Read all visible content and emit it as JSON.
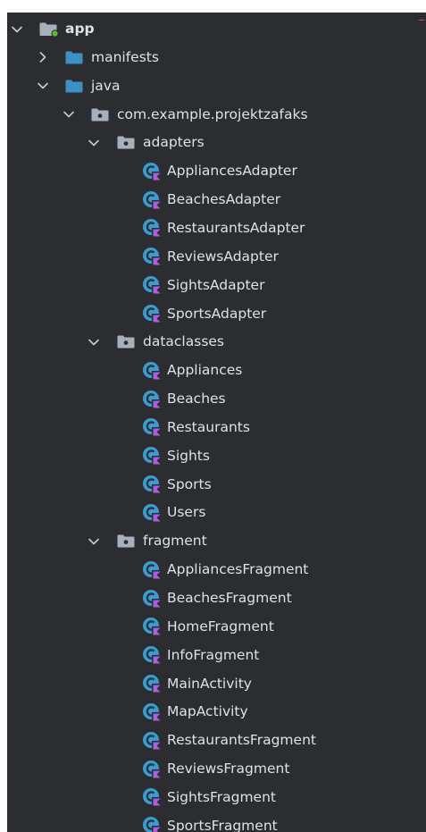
{
  "tree": {
    "root": {
      "label": "app",
      "expanded": true
    },
    "manifests": {
      "label": "manifests",
      "expanded": false
    },
    "java": {
      "label": "java",
      "expanded": true
    },
    "package": {
      "label": "com.example.projektzafaks",
      "expanded": true
    },
    "adapters": {
      "label": "adapters",
      "expanded": true,
      "files": [
        "AppliancesAdapter",
        "BeachesAdapter",
        "RestaurantsAdapter",
        "ReviewsAdapter",
        "SightsAdapter",
        "SportsAdapter"
      ]
    },
    "dataclasses": {
      "label": "dataclasses",
      "expanded": true,
      "files": [
        "Appliances",
        "Beaches",
        "Restaurants",
        "Sights",
        "Sports",
        "Users"
      ]
    },
    "fragment": {
      "label": "fragment",
      "expanded": true,
      "files": [
        "AppliancesFragment",
        "BeachesFragment",
        "HomeFragment",
        "InfoFragment",
        "MainActivity",
        "MapActivity",
        "RestaurantsFragment",
        "ReviewsFragment",
        "SightsFragment",
        "SportsFragment"
      ]
    }
  },
  "icons": {
    "module": "module-folder-icon",
    "folder": "folder-icon",
    "package": "package-icon",
    "kotlin_class": "kotlin-class-icon",
    "chevron_down": "chevron-down-icon",
    "chevron_right": "chevron-right-icon"
  },
  "colors": {
    "background": "#2b2d30",
    "text": "#dfe1e5",
    "folder_blue": "#3d8fc6",
    "class_teal": "#3a9ccf",
    "module_dot": "#5fb832",
    "error_squiggle": "#d65454"
  }
}
